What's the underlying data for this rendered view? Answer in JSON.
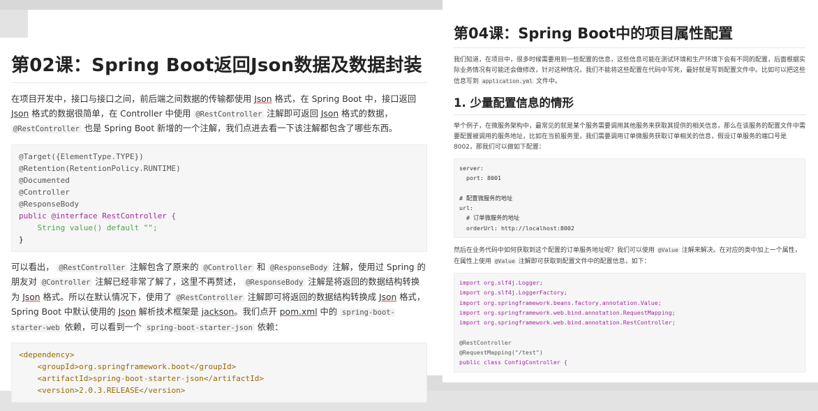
{
  "left": {
    "title": "第02课：Spring Boot返回Json数据及数据封装",
    "intro": [
      "在项目开发中，接口与接口之间，前后端之间数据的传输都使用 ",
      "Json",
      " 格式，在 Spring Boot 中，接口返回 ",
      "Json",
      " 格式的数据很简单，在 Controller 中使用 ",
      "@RestController",
      " 注解即可返回 ",
      "Json",
      " 格式的数据，",
      "@RestController",
      " 也是 Spring Boot 新增的一个注解，我们点进去看一下该注解都包含了哪些东西。"
    ],
    "code1": [
      "@Target({ElementType.TYPE})",
      "@Retention(RetentionPolicy.RUNTIME)",
      "@Documented",
      "@Controller",
      "@ResponseBody",
      "public @interface RestController {",
      "    String value() default \"\";",
      "}"
    ],
    "para2": [
      "可以看出， ",
      "@RestController",
      " 注解包含了原来的 ",
      "@Controller",
      " 和 ",
      "@ResponseBody",
      " 注解，使用过 Spring 的朋友对 ",
      "@Controller",
      " 注解已经非常了解了，这里不再赘述， ",
      "@ResponseBody",
      " 注解是将返回的数据结构转换为 ",
      "Json",
      " 格式。所以在默认情况下，使用了 ",
      "@RestController",
      " 注解即可将返回的数据结构转换成 ",
      "Json",
      " 格式，Spring Boot 中默认使用的 ",
      "Json",
      " 解析技术框架是 ",
      "jackson",
      "。我们点开 ",
      "pom.xml",
      " 中的 ",
      "spring-boot-starter-web",
      " 依赖，可以看到一个 ",
      "spring-boot-starter-json",
      " 依赖："
    ],
    "code2": [
      "<dependency>",
      "    <groupId>org.springframework.boot</groupId>",
      "    <artifactId>spring-boot-starter-json</artifactId>",
      "    <version>2.0.3.RELEASE</version>"
    ]
  },
  "right": {
    "title": "第04课：Spring Boot中的项目属性配置",
    "intro": [
      "我们知道，在项目中，很多时候需要用到一些配置的信息，这些信息可能在测试环境和生产环境下会有不同的配置，后面根据实际业务情况有可能还会做修改，针对这种情况，我们不能将这些配置在代码中写死，最好就是写到配置文件中。比如可以把这些信息写到 ",
      "application.yml",
      " 文件中。"
    ],
    "h2": "1. 少量配置信息的情形",
    "para2": "举个例子，在微服务架构中，最常见的就是某个服务需要调用其他服务来获取其提供的相关信息，那么在该服务的配置文件中需要配置被调用的服务地址，比如在当前服务里，我们需要调用订单微服务获取订单相关的信息，假设订单服务的端口号是 8002，那我们可以做如下配置：",
    "code1": [
      "server:",
      "  port: 8001",
      "",
      "# 配置微服务的地址",
      "url:",
      "  # 订单微服务的地址",
      "  orderUrl: http://localhost:8002"
    ],
    "para3": [
      "然后在业务代码中如何获取到这个配置的订单服务地址呢？我们可以使用 ",
      "@Value",
      " 注解来解决。在对应的类中加上一个属性，在属性上使用 ",
      "@Value",
      " 注解即可获取到配置文件中的配置信息，如下："
    ],
    "code2": [
      "import org.slf4j.Logger;",
      "import org.slf4j.LoggerFactory;",
      "import org.springframework.beans.factory.annotation.Value;",
      "import org.springframework.web.bind.annotation.RequestMapping;",
      "import org.springframework.web.bind.annotation.RestController;",
      "",
      "@RestController",
      "@RequestMapping(\"/test\")",
      "public class ConfigController {"
    ]
  }
}
